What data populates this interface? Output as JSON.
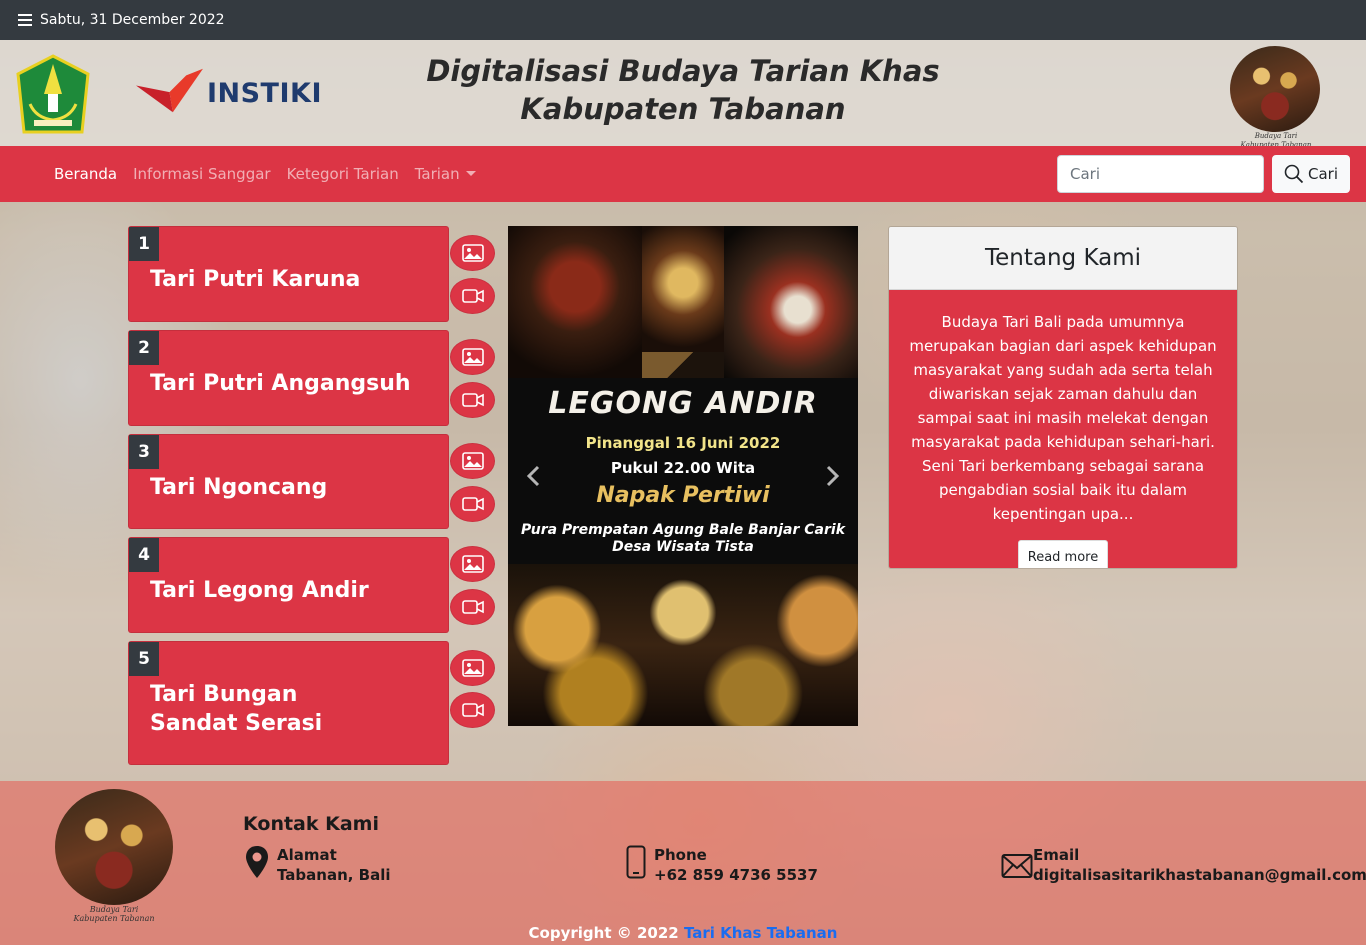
{
  "topbar": {
    "date": "Sabtu, 31 December 2022"
  },
  "header": {
    "title": "Digitalisasi Budaya Tarian Khas Kabupaten Tabanan",
    "instiki_label": "INSTIKI",
    "budaya_caption_1": "Budaya Tari",
    "budaya_caption_2": "Kabupaten Tabanan"
  },
  "nav": {
    "items": [
      {
        "label": "Beranda",
        "active": true
      },
      {
        "label": "Informasi Sanggar"
      },
      {
        "label": "Ketegori Tarian"
      },
      {
        "label": "Tarian"
      }
    ],
    "search_placeholder": "Cari",
    "search_button": "Cari"
  },
  "dances": [
    {
      "num": "1",
      "name": "Tari Putri Karuna"
    },
    {
      "num": "2",
      "name": "Tari Putri Angangsuh"
    },
    {
      "num": "3",
      "name": "Tari Ngoncang"
    },
    {
      "num": "4",
      "name": "Tari Legong Andir"
    },
    {
      "num": "5",
      "name": "Tari Bungan Sandat Serasi"
    }
  ],
  "carousel": {
    "title": "LEGONG ANDIR",
    "date": "Pinanggal 16 Juni 2022",
    "time": "Pukul 22.00 Wita",
    "event": "Napak Pertiwi",
    "place_1": "Pura Prempatan Agung Bale Banjar Carik",
    "place_2": "Desa Wisata Tista"
  },
  "about": {
    "title": "Tentang Kami",
    "text": "Budaya Tari Bali pada umumnya merupakan bagian dari aspek kehidupan masyarakat yang sudah ada serta telah diwariskan sejak zaman dahulu dan sampai saat ini masih melekat dengan masyarakat pada kehidupan sehari-hari. Seni Tari berkembang sebagai sarana pengabdian sosial baik itu dalam kepentingan upa...",
    "button": "Read more"
  },
  "footer": {
    "contact_title": "Kontak Kami",
    "address_label": "Alamat",
    "address_value": "Tabanan, Bali",
    "phone_label": "Phone",
    "phone_value": "+62 859 4736 5537",
    "email_label": "Email",
    "email_value": "digitalisasitarikhastabanan@gmail.com",
    "copyright_prefix": "Copyright © 2022",
    "copyright_link": "Tari Khas Tabanan",
    "logo_caption_1": "Budaya Tari",
    "logo_caption_2": "Kabupaten Tabanan"
  },
  "colors": {
    "primary": "#dc3545",
    "dark": "#343a40",
    "link": "#1a6cf0"
  }
}
